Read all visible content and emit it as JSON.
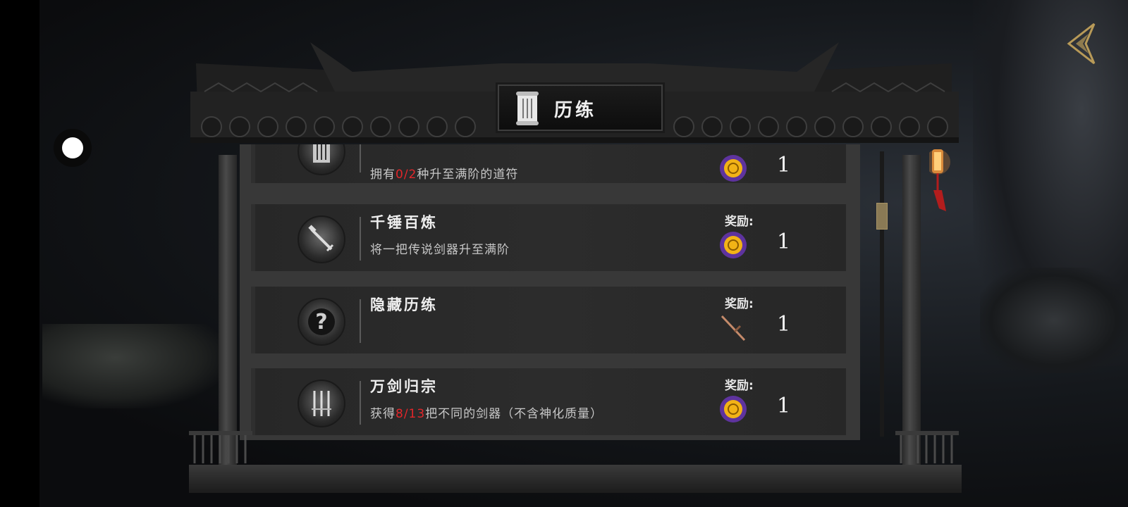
{
  "header": {
    "title": "历练",
    "back_icon": "back-icon",
    "scroll_icon": "scroll-icon"
  },
  "achievements": [
    {
      "title": "",
      "desc_prefix": "拥有",
      "desc_highlight": "0/2",
      "desc_suffix": "种升至满阶的道符",
      "reward_label": "",
      "reward_icon": "gold-coin-icon",
      "reward_count": "1",
      "badge_icon": "talisman-icon"
    },
    {
      "title": "千锤百炼",
      "desc_prefix": "将一把传说剑器升至满阶",
      "desc_highlight": "",
      "desc_suffix": "",
      "reward_label": "奖励:",
      "reward_icon": "gold-coin-icon",
      "reward_count": "1",
      "badge_icon": "hammer-sword-icon"
    },
    {
      "title": "隐藏历练",
      "desc_prefix": "",
      "desc_highlight": "",
      "desc_suffix": "",
      "reward_label": "奖励:",
      "reward_icon": "sword-icon",
      "reward_count": "1",
      "badge_icon": "question-mark-icon"
    },
    {
      "title": "万剑归宗",
      "desc_prefix": "获得",
      "desc_highlight": "8/13",
      "desc_suffix": "把不同的剑器（不含神化质量）",
      "reward_label": "奖励:",
      "reward_icon": "gold-coin-icon",
      "reward_count": "1",
      "badge_icon": "multi-sword-icon"
    }
  ],
  "colors": {
    "highlight": "#e3262a",
    "coin_glow": "#8a3cff",
    "coin_gold": "#f2b316",
    "scroll_thumb": "#8a7a55"
  }
}
